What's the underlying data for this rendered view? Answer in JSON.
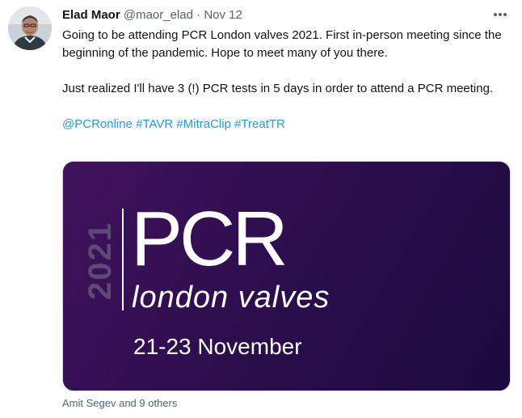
{
  "tweet": {
    "author_name": "Elad Maor",
    "handle": "@maor_elad",
    "separator": "·",
    "timestamp": "Nov 12",
    "text_line1": "Going to be attending PCR London valves 2021. First in-person meeting since the beginning of the pandemic. Hope to meet many of you there.",
    "text_line2": "Just realized I'll have 3 (!) PCR tests in 5 days in order to attend a PCR meeting.",
    "hashtags": [
      "@PCRonline",
      "#TAVR",
      "#MitraClip",
      "#TreatTR"
    ]
  },
  "media": {
    "year": "2021",
    "brand": "PCR",
    "subtitle": "london valves",
    "dates": "21-23 November"
  },
  "likers": "Amit Segev and 9 others",
  "icons": {
    "more": "more-horizontal-icon"
  },
  "colors": {
    "link": "#1d9bf0",
    "muted": "#536471",
    "banner_start": "#42125c",
    "banner_end": "#1c0a3e"
  }
}
